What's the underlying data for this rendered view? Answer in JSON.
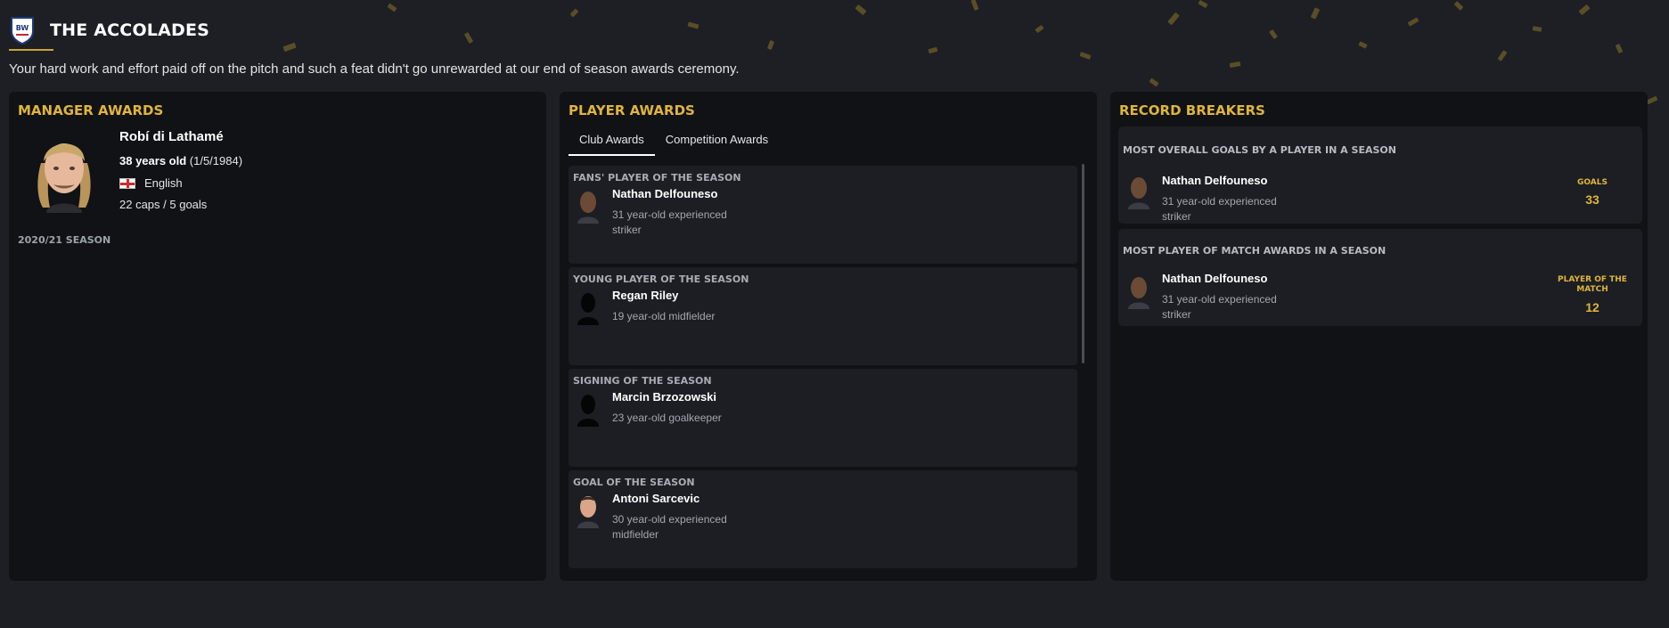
{
  "header": {
    "title": "THE ACCOLADES",
    "subtitle": "Your hard work and effort paid off on the pitch and such a feat didn't go unrewarded at our end of season awards ceremony."
  },
  "colors": {
    "accent": "#e0b53b",
    "panel": "#101216",
    "card": "#1c1e23",
    "background": "#1e1f24"
  },
  "manager_awards": {
    "title": "MANAGER AWARDS",
    "name": "Robí di Lathamé",
    "age": "38 years old",
    "dob": "(1/5/1984)",
    "nationality": "English",
    "nationality_icon": "england-flag-icon",
    "caps": "22 caps / 5 goals",
    "season_label": "2020/21 SEASON"
  },
  "player_awards": {
    "title": "PLAYER AWARDS",
    "tabs": [
      {
        "label": "Club Awards",
        "active": true
      },
      {
        "label": "Competition Awards",
        "active": false
      }
    ],
    "awards": [
      {
        "label": "FANS' PLAYER OF THE SEASON",
        "player": "Nathan Delfouneso",
        "desc": "31 year-old experienced striker",
        "photo": "player-photo-dark"
      },
      {
        "label": "YOUNG PLAYER OF THE SEASON",
        "player": "Regan Riley",
        "desc": "19 year-old midfielder",
        "photo": "silhouette"
      },
      {
        "label": "SIGNING OF THE SEASON",
        "player": "Marcin Brzozowski",
        "desc": "23 year-old goalkeeper",
        "photo": "silhouette"
      },
      {
        "label": "GOAL OF THE SEASON",
        "player": "Antoni Sarcevic",
        "desc": "30 year-old experienced midfielder",
        "photo": "player-photo-light"
      }
    ]
  },
  "record_breakers": {
    "title": "RECORD BREAKERS",
    "records": [
      {
        "label": "MOST OVERALL GOALS BY A PLAYER IN A SEASON",
        "player": "Nathan Delfouneso",
        "desc": "31 year-old experienced striker",
        "stat_label": "GOALS",
        "stat_value": "33"
      },
      {
        "label": "MOST PLAYER OF MATCH AWARDS IN A SEASON",
        "player": "Nathan Delfouneso",
        "desc": "31 year-old experienced striker",
        "stat_label": "PLAYER OF THE MATCH",
        "stat_value": "12"
      }
    ]
  }
}
